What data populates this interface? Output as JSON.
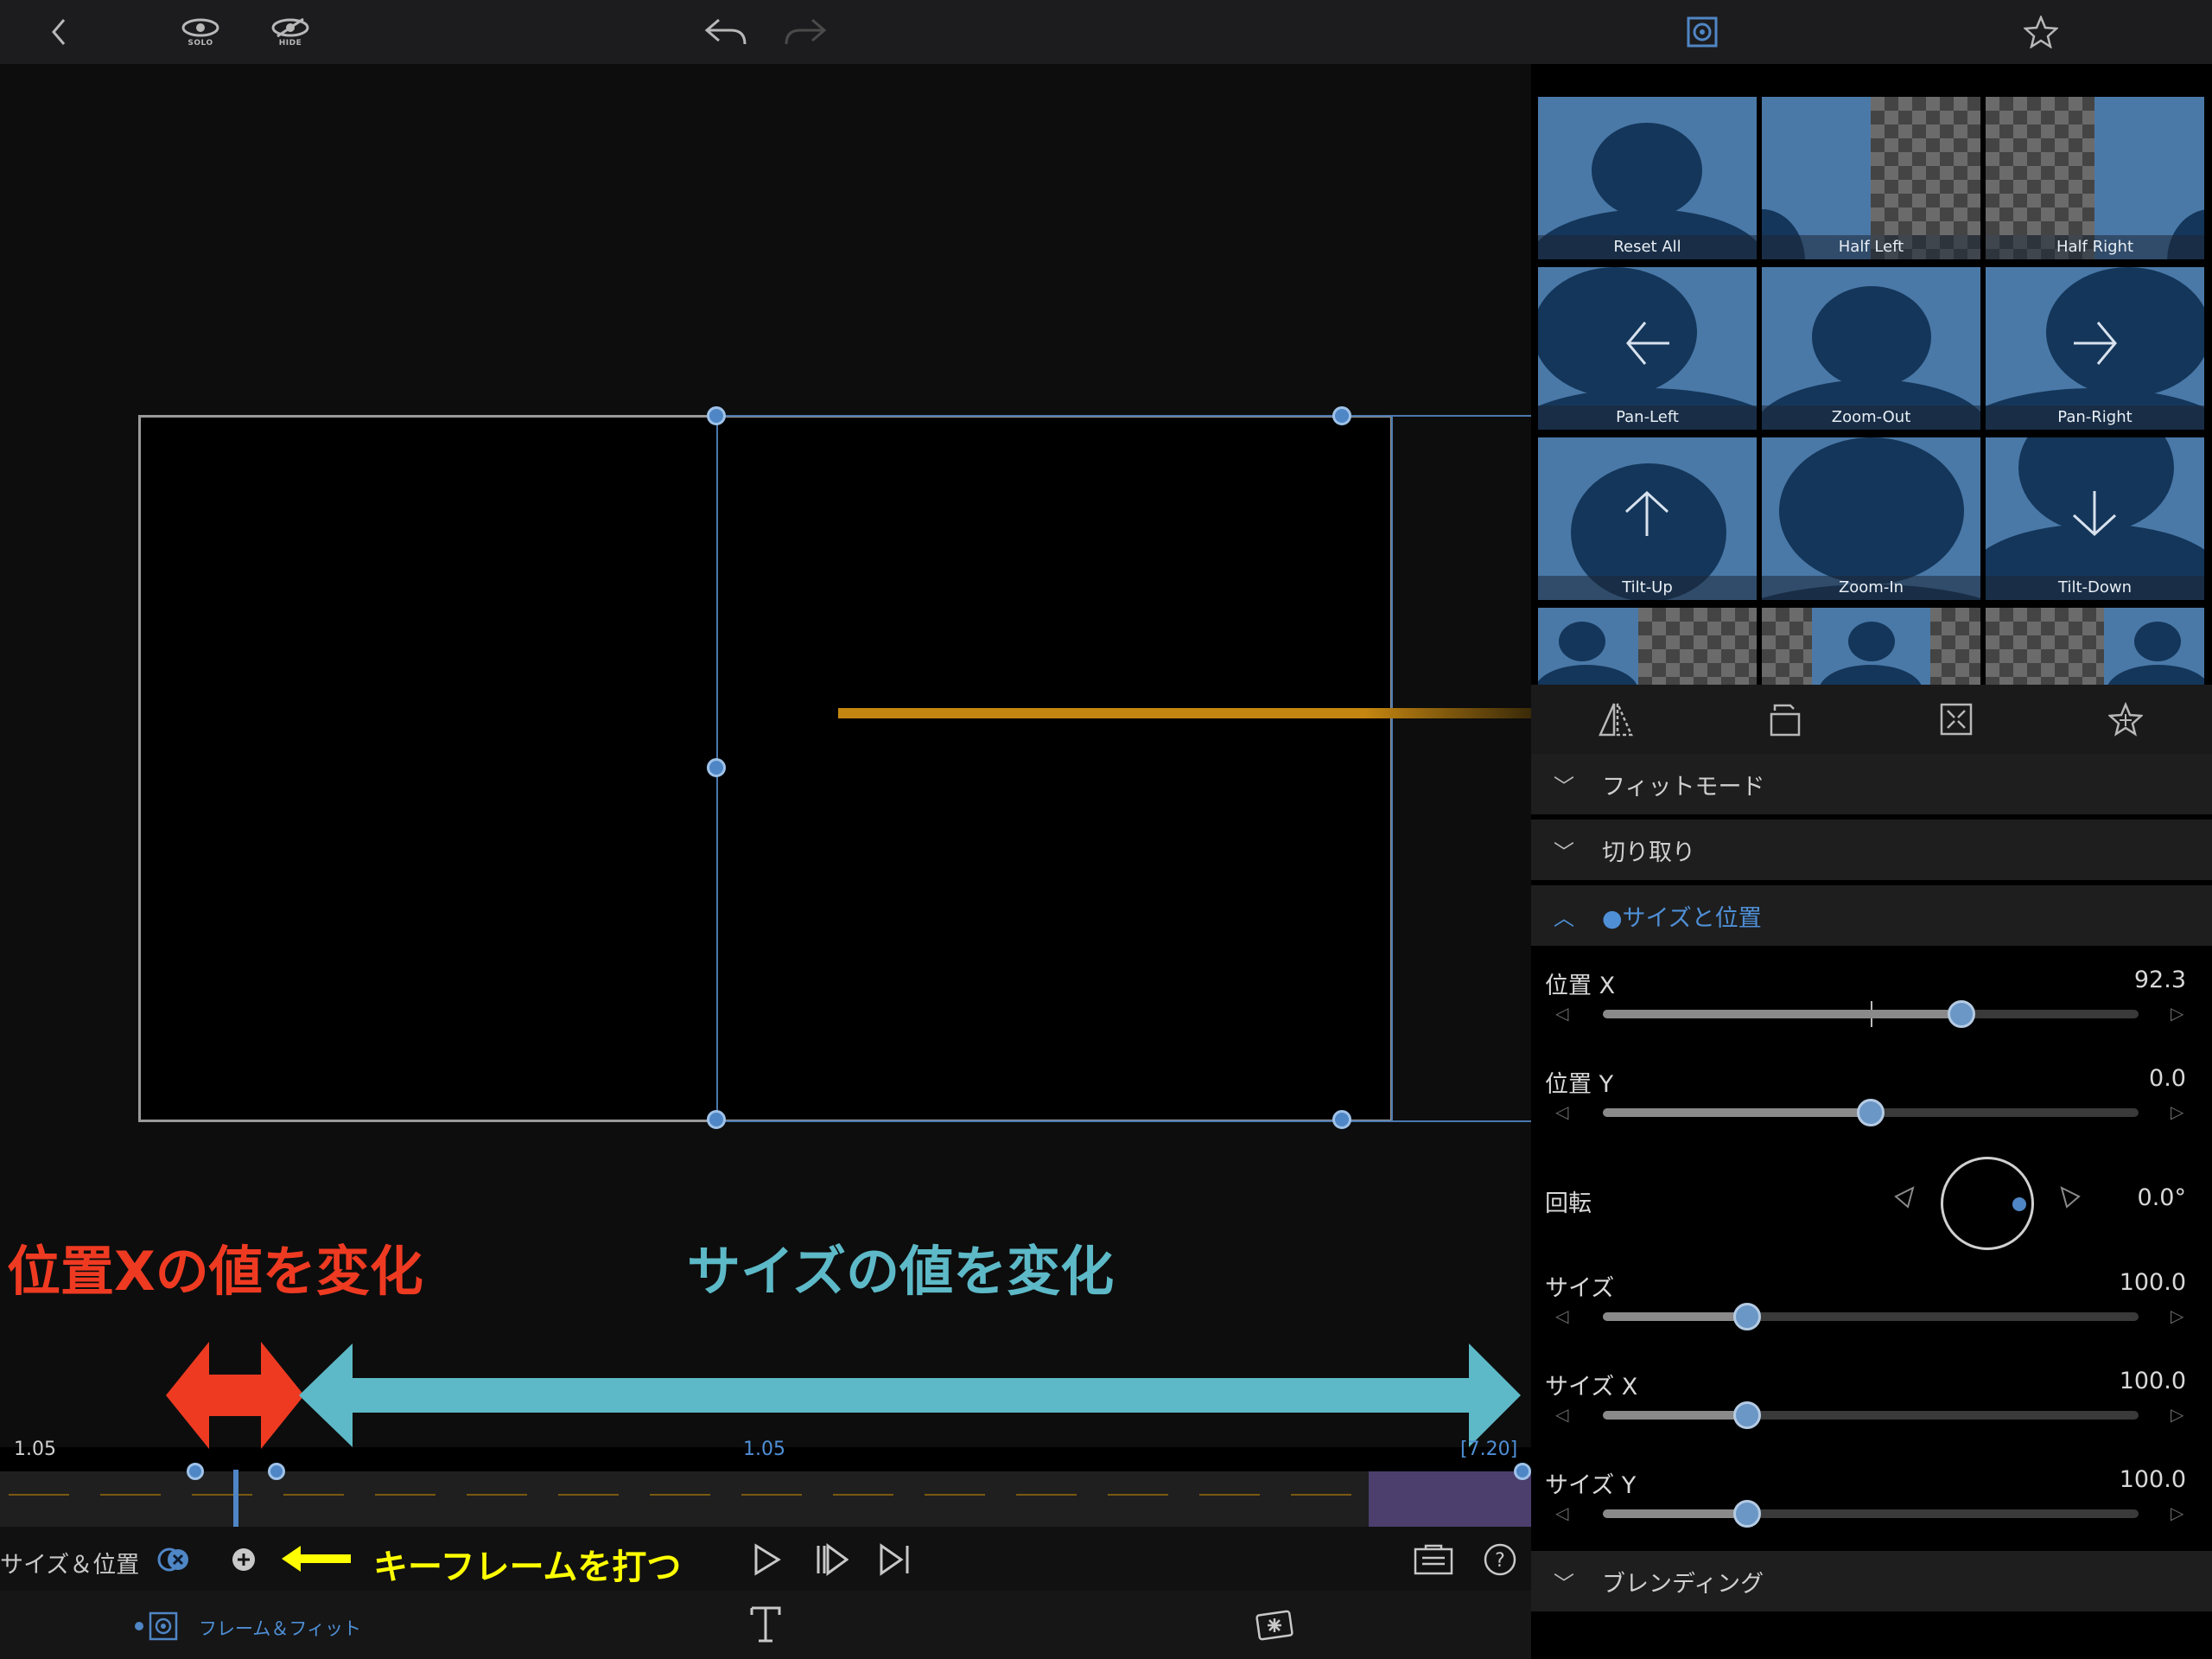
{
  "toolbar": {
    "back": "back-icon",
    "solo_label": "SOLO",
    "hide_label": "HIDE",
    "undo": "undo-icon",
    "redo": "redo-icon",
    "frame_fit": "frame-fit-icon",
    "favorites": "star-icon"
  },
  "annotations": {
    "position_x_change": "位置Xの値を変化",
    "size_change": "サイズの値を変化",
    "set_keyframe": "キーフレームを打つ",
    "red_arrow_color": "#ef3a22",
    "cyan_arrow_color": "#5db9c7",
    "yellow_color": "#ffff00"
  },
  "timeline": {
    "start_time": "1.05",
    "current_time": "1.05",
    "end_time": "[7.20]",
    "playhead_fraction": 0.0,
    "accent": "#4f86c6"
  },
  "transport": {
    "track_label": "サイズ＆位置",
    "toggle": "keyframe-toggle-icon",
    "add": "add-keyframe-icon"
  },
  "tabs": {
    "frame_fit_label": "フレーム＆フィット"
  },
  "presets": [
    {
      "label": "Reset All"
    },
    {
      "label": "Half Left"
    },
    {
      "label": "Half Right"
    },
    {
      "label": "Pan-Left"
    },
    {
      "label": "Zoom-Out"
    },
    {
      "label": "Pan-Right"
    },
    {
      "label": "Tilt-Up"
    },
    {
      "label": "Zoom-In"
    },
    {
      "label": "Tilt-Down"
    }
  ],
  "sections": {
    "fit_mode": "フィットモード",
    "crop": "切り取り",
    "size_position": "●サイズと位置",
    "blending": "ブレンディング"
  },
  "params": {
    "pos_x": {
      "label": "位置 X",
      "value": "92.3",
      "fraction": 0.67
    },
    "pos_y": {
      "label": "位置 Y",
      "value": "0.0",
      "fraction": 0.5
    },
    "rotation": {
      "label": "回転",
      "value": "0.0°"
    },
    "size": {
      "label": "サイズ",
      "value": "100.0",
      "fraction": 0.27
    },
    "size_x": {
      "label": "サイズ X",
      "value": "100.0",
      "fraction": 0.27
    },
    "size_y": {
      "label": "サイズ Y",
      "value": "100.0",
      "fraction": 0.27
    }
  }
}
